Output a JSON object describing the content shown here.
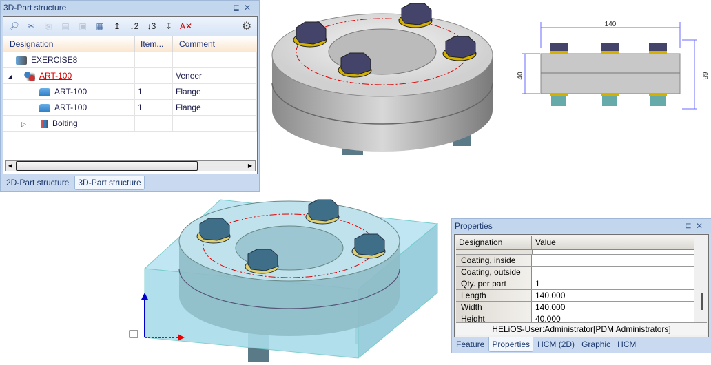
{
  "structure_panel": {
    "title": "3D-Part structure",
    "pin": "⊑",
    "close": "✕",
    "columns": [
      "Designation",
      "Item...",
      "Comment"
    ],
    "rows": [
      {
        "designation": "EXERCISE8",
        "item": "",
        "comment": "",
        "icon": "database-icon",
        "expander": ""
      },
      {
        "designation": "ART-100",
        "item": "",
        "comment": "Veneer",
        "icon": "assembly-icon",
        "expander": "◢"
      },
      {
        "designation": "ART-100",
        "item": "1",
        "comment": "Flange",
        "icon": "part-icon",
        "expander": ""
      },
      {
        "designation": "ART-100",
        "item": "1",
        "comment": "Flange",
        "icon": "part-icon",
        "expander": ""
      },
      {
        "designation": "Bolting",
        "item": "",
        "comment": "",
        "icon": "bolting-icon",
        "expander": "▷"
      }
    ],
    "tabs": [
      "2D-Part structure",
      "3D-Part structure"
    ],
    "active_tab": "3D-Part structure"
  },
  "drawing": {
    "dim_length": "140",
    "dim_height": "40",
    "dim_total": "68"
  },
  "properties_panel": {
    "title": "Properties",
    "pin": "⊑",
    "close": "✕",
    "columns": [
      "Designation",
      "Value"
    ],
    "rows": [
      {
        "key": "Coating, inside",
        "value": ""
      },
      {
        "key": "Coating, outside",
        "value": ""
      },
      {
        "key": "Qty. per part",
        "value": "1"
      },
      {
        "key": "Length",
        "value": "140.000"
      },
      {
        "key": "Width",
        "value": "140.000"
      },
      {
        "key": "Height",
        "value": "40.000"
      }
    ],
    "status": "HELiOS-User:Administrator[PDM Administrators]",
    "tabs": [
      "Feature",
      "Properties",
      "HCM (2D)",
      "Graphic",
      "HCM"
    ],
    "active_tab": "Properties"
  },
  "colors": {
    "accent": "#e00000",
    "panel": "#c9daf0",
    "bolt": "#4a4a6a",
    "washer": "#d4b000"
  }
}
